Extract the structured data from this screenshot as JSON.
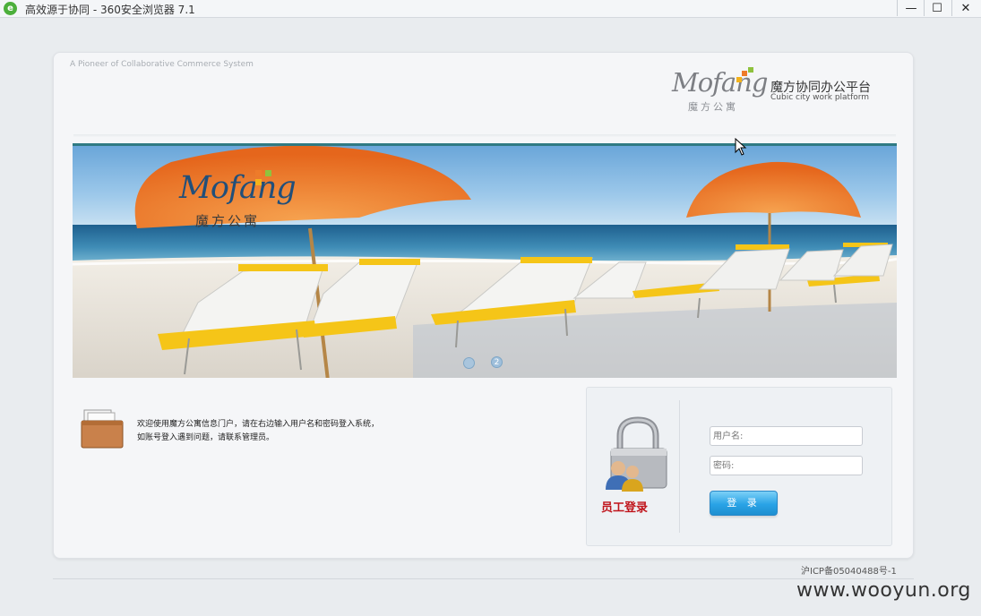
{
  "window": {
    "title": "高效源于协同 - 360安全浏览器 7.1",
    "icon": "ie-style-browser-icon",
    "minimize": "—",
    "maximize": "☐",
    "close": "✕"
  },
  "header": {
    "tagline": "A Pioneer of Collaborative Commerce System",
    "logo_text": "Mofang",
    "logo_sub": "魔方公寓",
    "brand_cn": "魔方协同办公平台",
    "brand_en": "Cubic city work platform",
    "logo_colors": [
      "#ee7b2a",
      "#f3b21c",
      "#8fc23e"
    ]
  },
  "banner": {
    "umbrella_logo_text": "Mofang",
    "umbrella_logo_sub": "魔方公寓",
    "slide_2_label": "2",
    "slide_count": 2,
    "active_slide": 2
  },
  "welcome": {
    "line1": "欢迎使用魔方公寓信息门户，请在右边输入用户名和密码登入系统，",
    "line2": "如账号登入遇到问题，请联系管理员。"
  },
  "login": {
    "title": "员工登录",
    "username_placeholder": "用户名:",
    "password_placeholder": "密码:",
    "submit_label": "登 录",
    "accent_color": "#29a3e6",
    "title_color": "#c0141b"
  },
  "footer": {
    "icp": "沪ICP备05040488号-1",
    "watermark": "www.wooyun.org"
  }
}
